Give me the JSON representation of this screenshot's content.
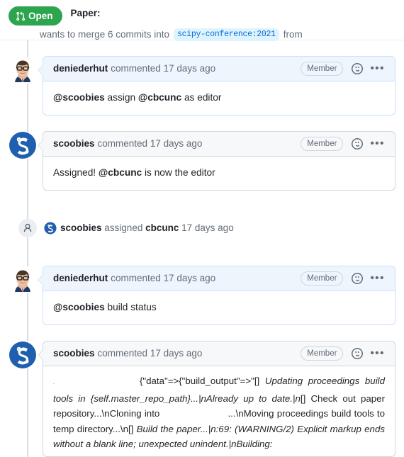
{
  "header": {
    "state_label": "Open",
    "state_color": "#2da44e",
    "title": "Paper:",
    "merge_text": "wants to merge 6 commits into",
    "base_branch": "scipy-conference:2021",
    "from_text": "from"
  },
  "timeline": [
    {
      "type": "comment",
      "avatar": "deniederhut-avatar",
      "author": "deniederhut",
      "action": "commented 17 days ago",
      "badge": "Member",
      "is_author_highlight": true,
      "body_parts": [
        {
          "text": "@scoobies",
          "style": "mention"
        },
        {
          "text": " assign ",
          "style": "plain"
        },
        {
          "text": "@cbcunc",
          "style": "mention"
        },
        {
          "text": " as editor",
          "style": "plain"
        }
      ]
    },
    {
      "type": "comment",
      "avatar": "scoobies-avatar",
      "author": "scoobies",
      "action": "commented 17 days ago",
      "badge": "Member",
      "is_author_highlight": false,
      "body_parts": [
        {
          "text": "Assigned! ",
          "style": "plain"
        },
        {
          "text": "@cbcunc",
          "style": "mention"
        },
        {
          "text": " is now the editor",
          "style": "plain"
        }
      ]
    },
    {
      "type": "event",
      "icon": "person-icon",
      "avatar": "scoobies-avatar",
      "actor": "scoobies",
      "verb": "assigned",
      "target": "cbcunc",
      "timestamp": "17 days ago"
    },
    {
      "type": "comment",
      "avatar": "deniederhut-avatar",
      "author": "deniederhut",
      "action": "commented 17 days ago",
      "badge": "Member",
      "is_author_highlight": true,
      "body_parts": [
        {
          "text": "@scoobies",
          "style": "mention"
        },
        {
          "text": " build status",
          "style": "plain"
        }
      ]
    },
    {
      "type": "comment",
      "avatar": "scoobies-avatar",
      "author": "scoobies",
      "action": "commented 17 days ago",
      "badge": "Member",
      "is_author_highlight": false,
      "log_parts": [
        {
          "text": ".",
          "style": "tiny"
        },
        {
          "text": "{\"data\"=>{\"build_output\"=>\"[] ",
          "style": "plain"
        },
        {
          "text": "Updating proceedings build tools in {self.master_repo_path}...|nAlready up to date.|n",
          "style": "italic"
        },
        {
          "text": "[] Check out paper repository...\\nCloning into ",
          "style": "plain"
        },
        {
          "text": "...\\nMoving proceedings build tools to temp directory...\\n",
          "style": "plain"
        },
        {
          "text": "[] ",
          "style": "plain"
        },
        {
          "text": "Build the paper...|n:69: (WARNING/2) Explicit markup ends without a blank line; unexpected unindent.|nBuilding:",
          "style": "italic"
        }
      ]
    }
  ],
  "icons": {
    "reaction": "smiley-icon",
    "kebab": "kebab-menu-icon",
    "pull_request": "git-pull-request-icon",
    "person": "person-icon"
  }
}
